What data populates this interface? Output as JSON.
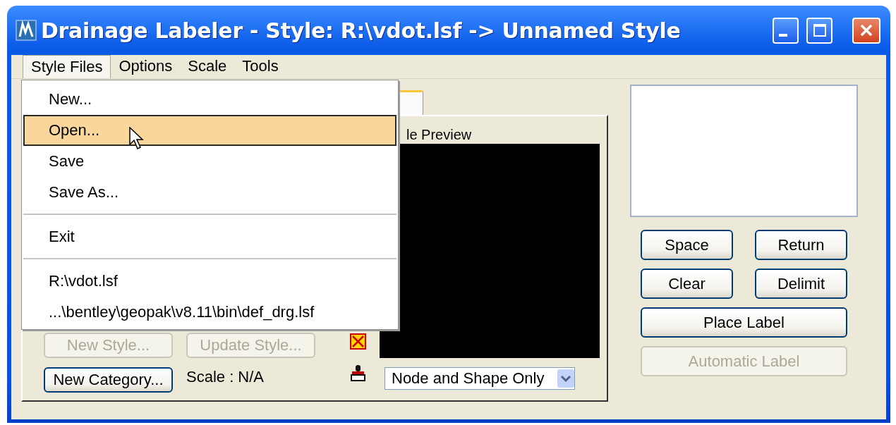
{
  "window": {
    "title": "Drainage Labeler - Style: R:\\vdot.lsf -> Unnamed Style"
  },
  "menu_bar": [
    {
      "label": "Style Files",
      "selected": true
    },
    {
      "label": "Options",
      "selected": false
    },
    {
      "label": "Scale",
      "selected": false
    },
    {
      "label": "Tools",
      "selected": false
    }
  ],
  "dropdown_menu": [
    {
      "kind": "item",
      "label": "New...",
      "selected": false
    },
    {
      "kind": "item",
      "label": "Open...",
      "selected": true
    },
    {
      "kind": "item",
      "label": "Save",
      "selected": false
    },
    {
      "kind": "item",
      "label": "Save As...",
      "selected": false
    },
    {
      "kind": "separator"
    },
    {
      "kind": "item",
      "label": "Exit",
      "selected": false
    },
    {
      "kind": "separator"
    },
    {
      "kind": "item",
      "label": "R:\\vdot.lsf",
      "selected": false
    },
    {
      "kind": "item",
      "label": "...\\bentley\\geopak\\v8.11\\bin\\def_drg.lsf",
      "selected": false
    }
  ],
  "style_panel": {
    "preview_label": "le Preview",
    "style_buttons": [
      {
        "label": "New Style...",
        "disabled": true
      },
      {
        "label": "Update Style...",
        "disabled": true
      }
    ],
    "new_category_button": {
      "label": "New Category...",
      "disabled": false
    },
    "scale_label": "Scale : N/A",
    "preview_mode": {
      "value": "Node and Shape Only"
    }
  },
  "label_panel": {
    "buttons": [
      {
        "kind": "half",
        "label": "Space",
        "disabled": false
      },
      {
        "kind": "half",
        "label": "Return",
        "disabled": false
      },
      {
        "kind": "half",
        "label": "Clear",
        "disabled": false
      },
      {
        "kind": "half",
        "label": "Delimit",
        "disabled": false
      },
      {
        "kind": "full",
        "label": "Place Label",
        "disabled": false
      },
      {
        "kind": "full",
        "label": "Automatic Label",
        "disabled": true
      }
    ]
  }
}
